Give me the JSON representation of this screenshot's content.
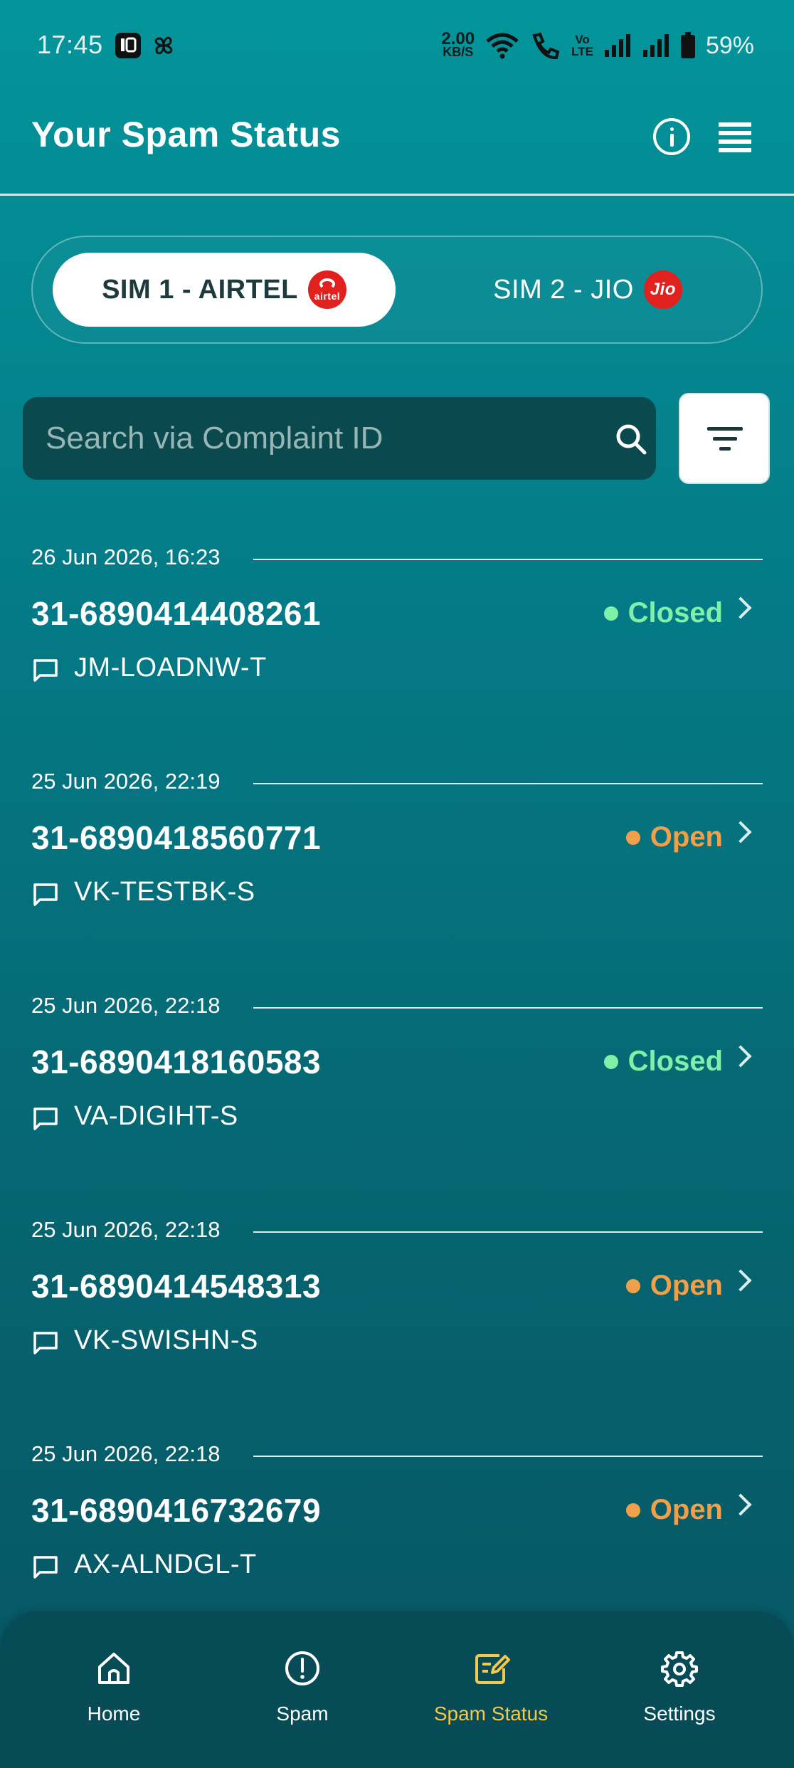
{
  "status_bar": {
    "time": "17:45",
    "net_speed_value": "2.00",
    "net_speed_unit": "KB/S",
    "volte_top": "Vo",
    "volte_bottom": "LTE",
    "battery": "59%"
  },
  "header": {
    "title": "Your Spam Status"
  },
  "sim_toggle": {
    "sim1_label": "SIM 1 - AIRTEL",
    "sim1_logo_text": "airtel",
    "sim2_label": "SIM 2 - JIO",
    "sim2_logo_text": "Jio"
  },
  "search": {
    "placeholder": "Search via Complaint ID"
  },
  "complaints": [
    {
      "date": "26 Jun 2026, 16:23",
      "id": "31-6890414408261",
      "status": "Closed",
      "sender": "JM-LOADNW-T"
    },
    {
      "date": "25 Jun 2026, 22:19",
      "id": "31-6890418560771",
      "status": "Open",
      "sender": "VK-TESTBK-S"
    },
    {
      "date": "25 Jun 2026, 22:18",
      "id": "31-6890418160583",
      "status": "Closed",
      "sender": "VA-DIGIHT-S"
    },
    {
      "date": "25 Jun 2026, 22:18",
      "id": "31-6890414548313",
      "status": "Open",
      "sender": "VK-SWISHN-S"
    },
    {
      "date": "25 Jun 2026, 22:18",
      "id": "31-6890416732679",
      "status": "Open",
      "sender": "AX-ALNDGL-T"
    }
  ],
  "status_colors": {
    "Closed": "#7ef0a8",
    "Open": "#f0a04b"
  },
  "bottom_nav": {
    "items": [
      {
        "label": "Home",
        "icon": "home-icon"
      },
      {
        "label": "Spam",
        "icon": "alert-icon"
      },
      {
        "label": "Spam Status",
        "icon": "edit-note-icon",
        "active": true
      },
      {
        "label": "Settings",
        "icon": "gear-icon"
      }
    ]
  },
  "colors": {
    "accent_active_nav": "#f2c94c",
    "brand_red": "#e0211e"
  }
}
